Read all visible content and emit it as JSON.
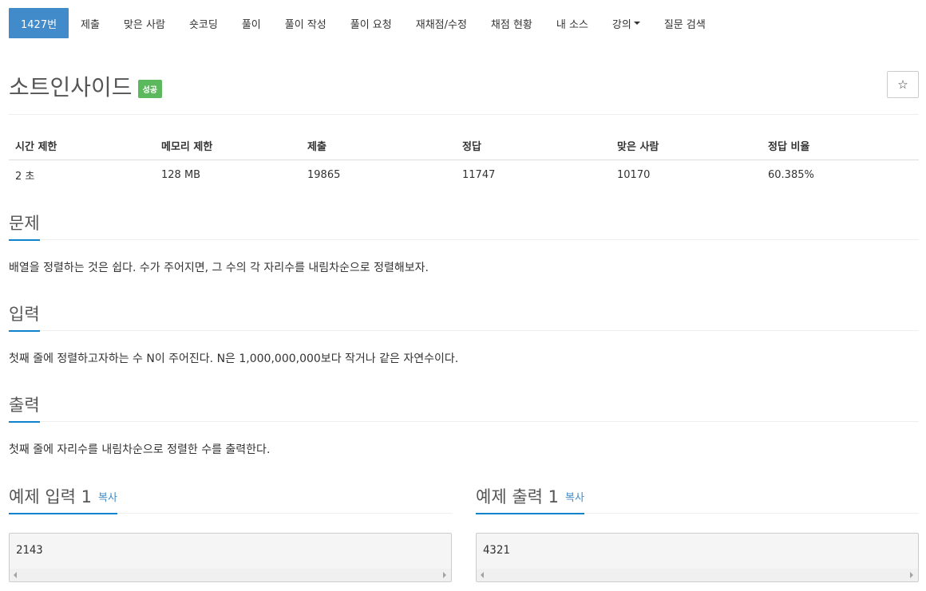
{
  "nav": {
    "items": [
      {
        "label": "1427번",
        "active": true
      },
      {
        "label": "제출"
      },
      {
        "label": "맞은 사람"
      },
      {
        "label": "숏코딩"
      },
      {
        "label": "풀이"
      },
      {
        "label": "풀이 작성"
      },
      {
        "label": "풀이 요청"
      },
      {
        "label": "재채점/수정"
      },
      {
        "label": "채점 현황"
      },
      {
        "label": "내 소스"
      },
      {
        "label": "강의",
        "dropdown": true
      },
      {
        "label": "질문 검색"
      }
    ]
  },
  "problem": {
    "title": "소트인사이드",
    "status_badge": "성공",
    "star_icon": "☆"
  },
  "info_table": {
    "headers": [
      "시간 제한",
      "메모리 제한",
      "제출",
      "정답",
      "맞은 사람",
      "정답 비율"
    ],
    "values": [
      "2 초",
      "128 MB",
      "19865",
      "11747",
      "10170",
      "60.385%"
    ]
  },
  "sections": {
    "problem": {
      "heading": "문제",
      "body": "배열을 정렬하는 것은 쉽다. 수가 주어지면, 그 수의 각 자리수를 내림차순으로 정렬해보자."
    },
    "input": {
      "heading": "입력",
      "body": "첫째 줄에 정렬하고자하는 수 N이 주어진다. N은 1,000,000,000보다 작거나 같은 자연수이다."
    },
    "output": {
      "heading": "출력",
      "body": "첫째 줄에 자리수를 내림차순으로 정렬한 수를 출력한다."
    }
  },
  "samples": {
    "input": {
      "heading": "예제 입력 1",
      "copy": "복사",
      "code": "2143"
    },
    "output": {
      "heading": "예제 출력 1",
      "copy": "복사",
      "code": "4321"
    }
  },
  "colors": {
    "accent": "#428bca",
    "success": "#5cb85c",
    "section_underline": "#0e83cd"
  }
}
